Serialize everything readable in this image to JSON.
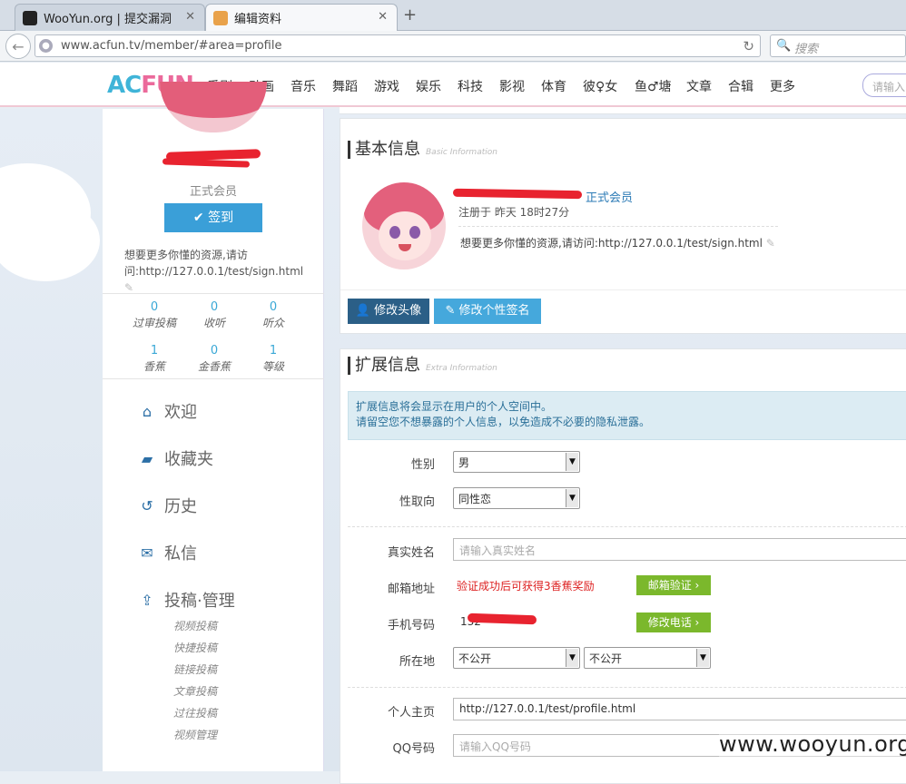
{
  "browser": {
    "tabs": [
      {
        "title": "WooYun.org | 提交漏洞"
      },
      {
        "title": "编辑资料"
      }
    ],
    "url": "www.acfun.tv/member/#area=profile",
    "search_placeholder": "搜索"
  },
  "site": {
    "logo_a": "AC",
    "logo_b": "FUN",
    "nav": [
      "番剧",
      "动画",
      "音乐",
      "舞蹈",
      "游戏",
      "娱乐",
      "科技",
      "影视",
      "体育",
      "彼♀女",
      "鱼♂塘",
      "文章",
      "合辑",
      "更多"
    ],
    "login_placeholder": "请输入"
  },
  "sidebar": {
    "rank": "正式会员",
    "sign_button": "签到",
    "signature": "想要更多你懂的资源,请访问:http://127.0.0.1/test/sign.html",
    "stats": [
      {
        "value": "0",
        "label": "过审投稿"
      },
      {
        "value": "0",
        "label": "收听"
      },
      {
        "value": "0",
        "label": "听众"
      },
      {
        "value": "1",
        "label": "香蕉"
      },
      {
        "value": "0",
        "label": "金香蕉"
      },
      {
        "value": "1",
        "label": "等级"
      }
    ],
    "menu": [
      {
        "label": "欢迎",
        "icon": "home-icon"
      },
      {
        "label": "收藏夹",
        "icon": "folder-icon"
      },
      {
        "label": "历史",
        "icon": "history-icon"
      },
      {
        "label": "私信",
        "icon": "mail-icon"
      },
      {
        "label": "投稿·管理",
        "icon": "upload-icon"
      }
    ],
    "submenu": [
      "视频投稿",
      "快捷投稿",
      "链接投稿",
      "文章投稿",
      "过往投稿",
      "视频管理"
    ]
  },
  "basic": {
    "title": "基本信息",
    "subtitle": "Basic Information",
    "rank": "正式会员",
    "registered": "注册于 昨天 18时27分",
    "signature": "想要更多你懂的资源,请访问:http://127.0.0.1/test/sign.html",
    "btn_avatar": "修改头像",
    "btn_signature": "修改个性签名"
  },
  "extra": {
    "title": "扩展信息",
    "subtitle": "Extra Information",
    "notice_line1": "扩展信息将会显示在用户的个人空间中。",
    "notice_line2": "请留空您不想暴露的个人信息，以免造成不必要的隐私泄露。",
    "gender_label": "性别",
    "gender_value": "男",
    "orientation_label": "性取向",
    "orientation_value": "同性恋",
    "realname_label": "真实姓名",
    "realname_placeholder": "请输入真实姓名",
    "email_label": "邮箱地址",
    "email_note": "验证成功后可获得3香蕉奖励",
    "email_button": "邮箱验证 ›",
    "phone_label": "手机号码",
    "phone_value": "132",
    "phone_button": "修改电话 ›",
    "location_label": "所在地",
    "location_value1": "不公开",
    "location_value2": "不公开",
    "homepage_label": "个人主页",
    "homepage_value": "http://127.0.0.1/test/profile.html",
    "qq_label": "QQ号码",
    "qq_placeholder": "请输入QQ号码"
  },
  "watermark": "www.wooyun.org"
}
